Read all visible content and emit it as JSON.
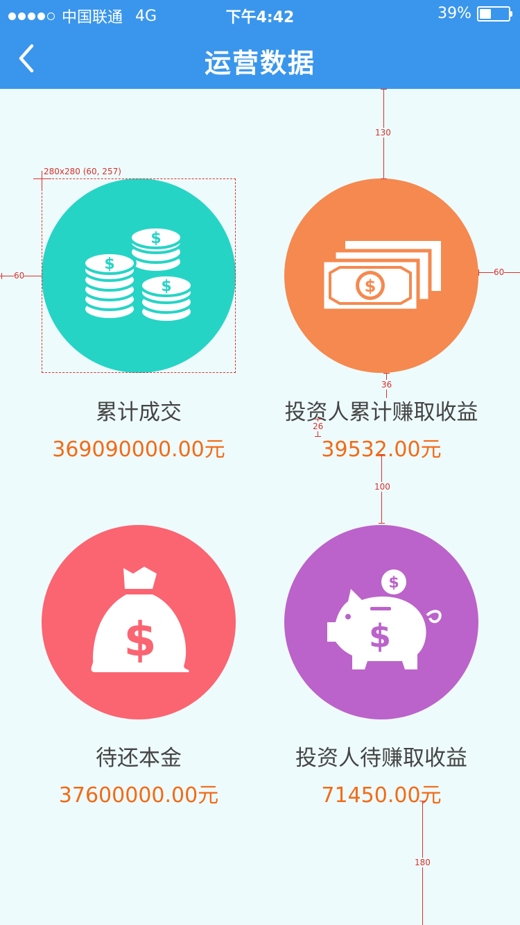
{
  "status_bar": {
    "carrier": "中国联通",
    "network": "4G",
    "time": "下午4:42",
    "battery_text": "39%",
    "battery_level": 0.39
  },
  "nav": {
    "title": "运营数据",
    "back_icon": "chevron-left-icon"
  },
  "stats": [
    {
      "label": "累计成交",
      "value": "369090000.00元",
      "icon": "coins-icon",
      "color": "#26d4c6"
    },
    {
      "label": "投资人累计赚取收益",
      "value": "39532.00元",
      "icon": "banknotes-icon",
      "color": "#f5894f"
    },
    {
      "label": "待还本金",
      "value": "37600000.00元",
      "icon": "money-bag-icon",
      "color": "#fb6471"
    },
    {
      "label": "投资人待赚取收益",
      "value": "71450.00元",
      "icon": "piggy-bank-icon",
      "color": "#bb63ca"
    }
  ],
  "annotations": {
    "box_caption": "280x280 (60, 257)",
    "top_gap": "130",
    "left_margin": "60",
    "right_margin": "60",
    "label_gap": "36",
    "value_gap": "26",
    "row_gap": "100",
    "bottom_gap": "180"
  }
}
